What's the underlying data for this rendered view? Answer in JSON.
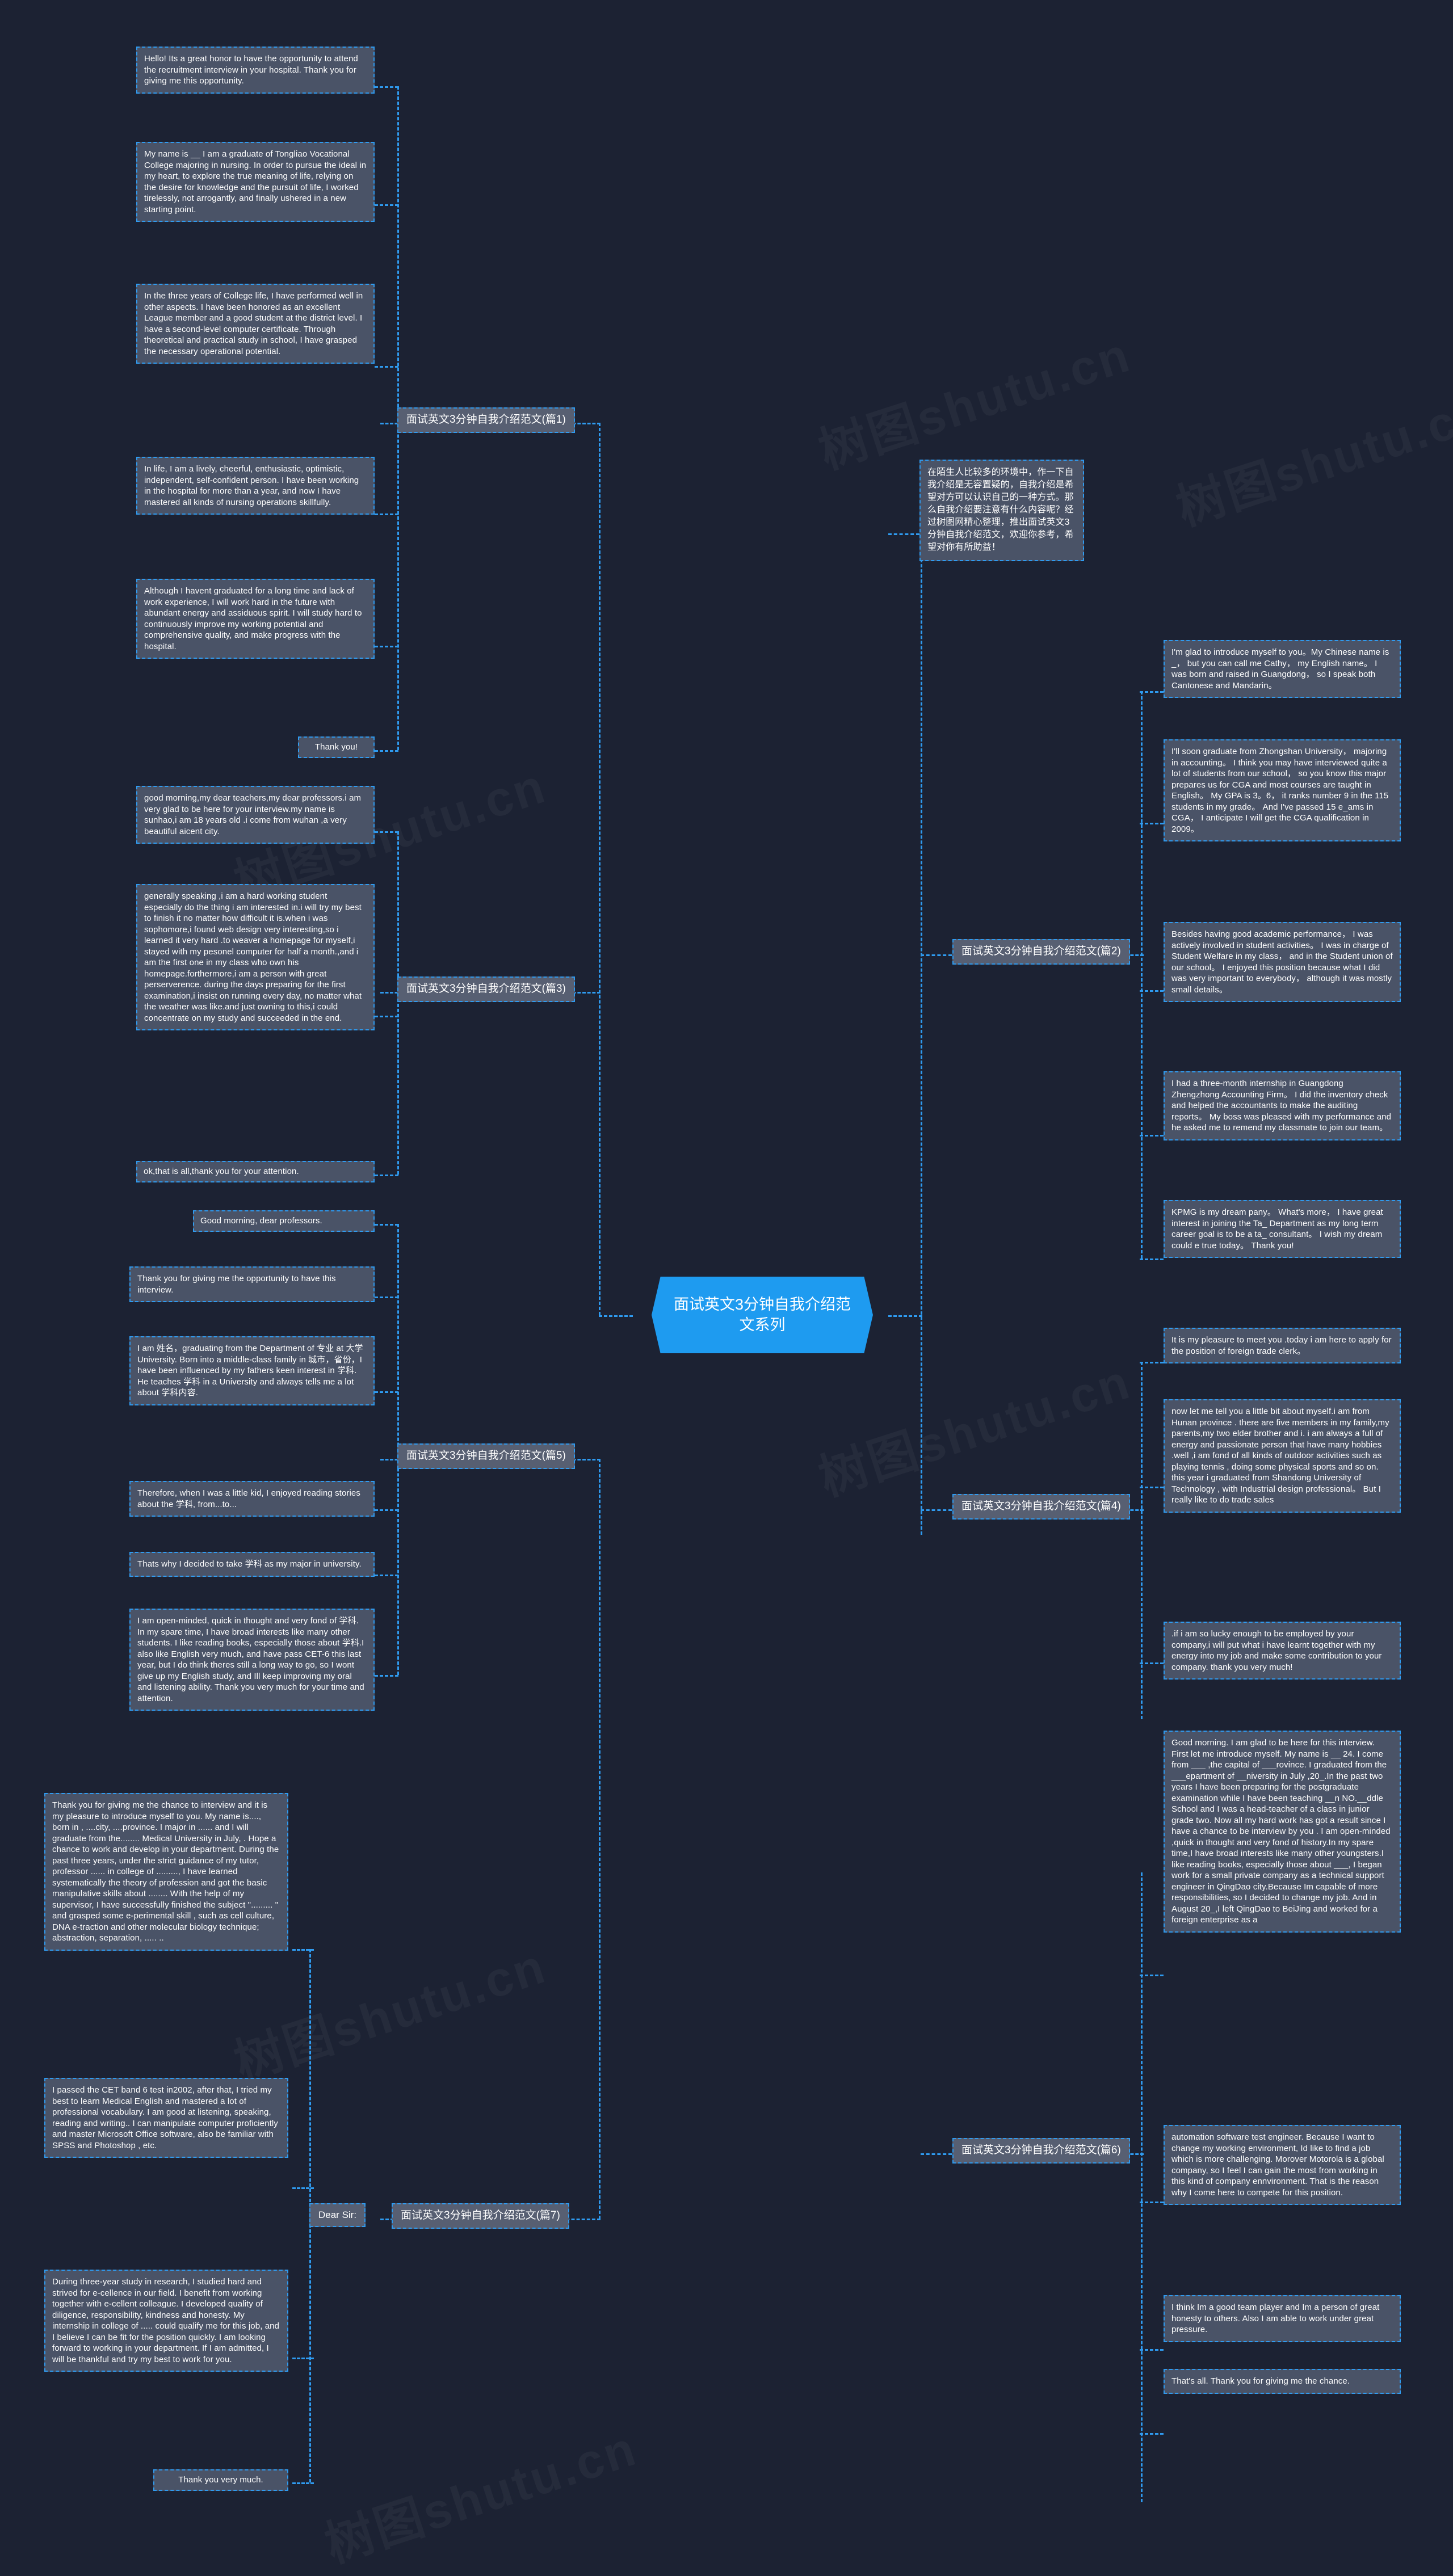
{
  "center": {
    "title": "面试英文3分钟自我介绍范文系列"
  },
  "watermarks": [
    "树图shutu.cn",
    "树图shutu.cn",
    "树图shutu.cn",
    "树图shutu.cn",
    "树图shutu.cn",
    "树图shutu.cn"
  ],
  "branches": [
    {
      "label": "面试英文3分钟自我介绍范文(篇1)"
    },
    {
      "label": "面试英文3分钟自我介绍范文(篇3)"
    },
    {
      "label": "面试英文3分钟自我介绍范文(篇5)"
    },
    {
      "label": "面试英文3分钟自我介绍范文(篇7)"
    },
    {
      "label": "Dear Sir:"
    },
    {
      "label": "面试英文3分钟自我介绍范文(篇2)"
    },
    {
      "label": "面试英文3分钟自我介绍范文(篇4)"
    },
    {
      "label": "面试英文3分钟自我介绍范文(篇6)"
    }
  ],
  "intro": "在陌生人比较多的环境中，作一下自我介绍是无容置疑的，自我介绍是希望对方可以认识自己的一种方式。那么自我介绍要注意有什么内容呢？经过树图网精心整理，推出面试英文3分钟自我介绍范文，欢迎你参考，希望对你有所助益！",
  "piece1": [
    "Hello! Its a great honor to have the opportunity to attend the recruitment interview in your hospital. Thank you for giving me this opportunity.",
    "My name is __ I am a graduate of Tongliao Vocational College majoring in nursing. In order to pursue the ideal in my heart, to explore the true meaning of life, relying on the desire for knowledge and the pursuit of life, I worked tirelessly, not arrogantly, and finally ushered in a new starting point.",
    "In the three years of College life, I have performed well in other aspects. I have been honored as an excellent League member and a good student at the district level. I have a second-level computer certificate. Through theoretical and practical study in school, I have grasped the necessary operational potential.",
    "In life, I am a lively, cheerful, enthusiastic, optimistic, independent, self-confident person. I have been working in the hospital for more than a year, and now I have mastered all kinds of nursing operations skillfully.",
    "Although I havent graduated for a long time and lack of work experience, I will work hard in the future with abundant energy and assiduous spirit. I will study hard to continuously improve my working potential and comprehensive quality, and make progress with the hospital.",
    "Thank you!"
  ],
  "piece3": [
    "good morning,my dear teachers,my dear professors.i am very glad to be here for your interview.my name is sunhao,i am 18 years old .i come from wuhan ,a very beautiful aicent city.",
    "generally speaking ,i am a hard working student especially do the thing i am interested in.i will try my best to finish it no matter how difficult it is.when i was sophomore,i found web design very interesting,so i learned it very hard .to weaver a homepage for myself,i stayed with my pesonel computer for half a month.,and i am the first one in my class who own his homepage.forthermore,i am a person with great perserverence. during the days preparing for the first examination,i insist on running every day, no matter what the weather was like.and just owning to this,i could concentrate on my study and succeeded in the end.",
    "ok,that is all,thank you for your attention."
  ],
  "piece5": [
    "Good morning, dear professors.",
    "Thank you for giving me the opportunity to have this interview.",
    "I am 姓名，graduating from the Department of 专业 at 大学 University. Born into a middle-class family in 城市，省份，I have been influenced by my fathers keen interest in 学科. He teaches 学科 in a University and always tells me a lot about 学科内容.",
    "Therefore, when I was a little kid, I enjoyed reading stories about the 学科, from...to...",
    "Thats why I decided to take 学科 as my major in university.",
    "I am open-minded, quick in thought and very fond of 学科. In my spare time, I have broad interests like many other students. I like reading books, especially those about 学科.I also like English very much, and have pass CET-6 this last year, but I do think theres still a long way to go, so I wont give up my English study, and Ill keep improving my oral and listening ability. Thank you very much for your time and attention."
  ],
  "piece7": [
    "Thank you for giving me the chance to interview and it is my pleasure to introduce myself to you. My name is....,  born in , ....city, ....province. I major in ...... and I will graduate from the........ Medical University in July, . Hope a chance to work and develop in your department. During the past three years, under the strict guidance of my tutor, professor ...... in college of ........., I have learned systematically the theory of profession and got the basic manipulative skills about ........ With the help of my supervisor, I have successfully finished the subject \"......... \" and grasped some e-perimental skill , such as cell culture, DNA e-traction and other molecular biology technique; abstraction, separation, ..... ..",
    "I passed the CET band 6 test in2002, after that, I tried my best to learn Medical English and mastered a lot of professional vocabulary. I am good at listening, speaking, reading and writing.. I can manipulate computer proficiently and master Microsoft Office software, also be familiar with SPSS and Photoshop , etc.",
    "During three-year study in research, I studied hard and strived for e-cellence in our field. I benefit from working together with e-cellent colleague. I developed quality of diligence, responsibility, kindness and honesty. My internship in college of ..... could qualify me for this job, and I believe I can be fit for the position quickly. I am looking forward to working in your department. If I am admitted, I will be thankful and try my best to work for you.",
    "Thank you very much."
  ],
  "piece2": [
    "I'm glad to introduce myself to you。My Chinese name is _， but you can call me Cathy， my English name。 I was born and raised in Guangdong， so I speak both Cantonese and Mandarin。",
    "I'll soon graduate from Zhongshan University， majoring in accounting。 I think you may have interviewed quite a lot of students from our school， so you know this major prepares us for CGA and most courses are taught in English。 My GPA is 3。6， it ranks number 9 in the 115 students in my grade。 And I've passed 15 e_ams in CGA， I anticipate I will get the CGA qualification in 2009。",
    "Besides having good academic performance， I was actively involved in student activities。 I was in charge of Student Welfare in my class， and in the Student union of our school。 I enjoyed this position because what I did was very important to everybody， although it was mostly small details。",
    "I had a three-month internship in Guangdong Zhengzhong Accounting Firm。 I did the inventory check and helped the accountants to make the auditing reports。 My boss was pleased with my performance and he asked me to remend my classmate to join our team。",
    "KPMG is my dream pany。 What's more， I have great interest in joining the Ta_ Department as my long term career goal is to be a ta_ consultant。 I wish my dream could e true today。 Thank you!"
  ],
  "piece4": [
    "It is my pleasure to meet you .today i am here to apply for the position of foreign trade clerk。",
    "now let me tell you a little bit about myself.i am from Hunan province . there are five members in my family,my parents,my two elder brother and i. i am always a full of energy and passionate person that have many hobbies .well ,i am fond of all kinds of outdoor activities such as playing tennis , doing some physical sports and so on. this year i graduated from Shandong University of Technology , with Industrial design professional。 But I really like to do trade sales",
    ".if i am so lucky enough to be employed by your company,i will put what i have learnt together with my energy into my job and make some contribution to your company. thank you very much!"
  ],
  "piece6": [
    "Good morning. I am glad to be here for this interview. First let me introduce myself. My name is __ 24. I come from ___ ,the capital of ___rovince. I graduated from the ___epartment of __niversity in July ,20_.In the past two years I have been preparing for the postgraduate examination while I have been teaching __n NO.__ddle School and I was a head-teacher of a class in junior grade two. Now all my hard work has got a result since I have a chance to be interview by you . I am open-minded ,quick in thought and very fond of history.In my spare time,I have broad interests like many other youngsters.I like reading books, especially those about ___, I began work for a small private company as a technical support engineer in QingDao city.Because Im capable of more responsibilities, so I decided to change my job. And in August 20_,I left QingDao to BeiJing and worked for a foreign enterprise as a",
    "automation software test engineer. Because I want to change my working environment, Id like to find a job which is more challenging. Morover Motorola is a global company, so I feel I can gain the most from working in this kind of company ennvironment. That is the reason why I come here to compete for this position.",
    "I think Im a good team player and Im a person of great honesty to others. Also I am able to work under great pressure.",
    "That's all. Thank you for giving me the chance."
  ]
}
